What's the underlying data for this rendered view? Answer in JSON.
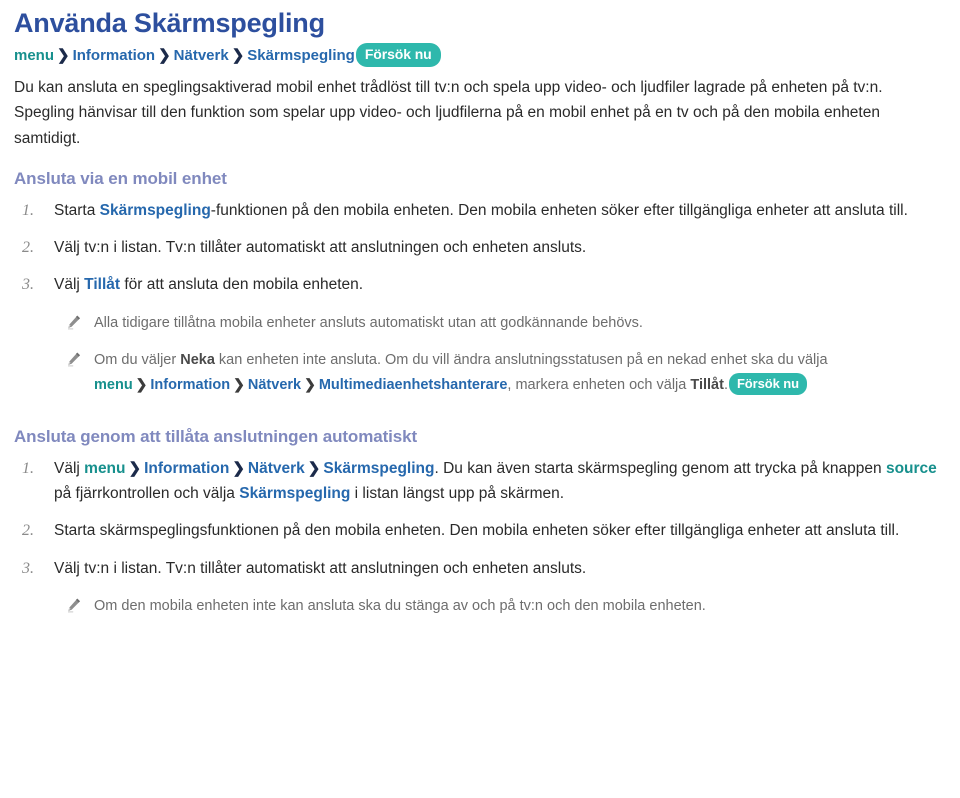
{
  "title": "Använda Skärmspegling",
  "colors": {
    "title_blue": "#2d4f9e",
    "link_blue": "#2668ad",
    "menu_teal": "#17908d",
    "badge_teal": "#2eb8ac",
    "heading_periwinkle": "#8089be",
    "note_gray": "#6d6d6d",
    "body_text": "#2a2a2a"
  },
  "breadcrumb": {
    "menu": "menu",
    "separator": "❯",
    "item1": "Information",
    "item2": "Nätverk",
    "item3": "Skärmspegling",
    "badge": "Försök nu"
  },
  "intro": "Du kan ansluta en speglingsaktiverad mobil enhet trådlöst till tv:n och spela upp video- och ljudfiler lagrade på enheten på tv:n. Spegling hänvisar till den funktion som spelar upp video- och ljudfilerna på en mobil enhet på en tv och på den mobila enheten samtidigt.",
  "section1": {
    "heading": "Ansluta via en mobil enhet",
    "steps": [
      {
        "num": "1.",
        "pre": "Starta ",
        "kw": "Skärmspegling",
        "post": "-funktionen på den mobila enheten. Den mobila enheten söker efter tillgängliga enheter att ansluta till."
      },
      {
        "num": "2.",
        "pre": "Välj tv:n i listan. Tv:n tillåter automatiskt att anslutningen och enheten ansluts.",
        "kw": "",
        "post": ""
      },
      {
        "num": "3.",
        "pre": "Välj ",
        "kw": "Tillåt",
        "post": " för att ansluta den mobila enheten."
      }
    ],
    "notes": [
      {
        "icon": "pencil-icon",
        "text": "Alla tidigare tillåtna mobila enheter ansluts automatiskt utan att godkännande behövs."
      }
    ],
    "note2": {
      "icon": "pencil-icon",
      "line1_pre": "Om du väljer ",
      "line1_kw": "Neka",
      "line1_post": " kan enheten inte ansluta. Om du vill ändra anslutningsstatusen på en nekad enhet ska du välja",
      "crumb_menu": "menu",
      "crumb_sep": "❯",
      "crumb1": "Information",
      "crumb2": "Nätverk",
      "crumb3": "Multimediaenhetshanterare",
      "line2_mid": ", markera enheten och välja ",
      "line2_kw": "Tillåt",
      "line2_end": ".",
      "badge": "Försök nu"
    }
  },
  "section2": {
    "heading": "Ansluta genom att tillåta anslutningen automatiskt",
    "step1": {
      "num": "1.",
      "pre": "Välj ",
      "crumb_menu": "menu",
      "crumb_sep": "❯",
      "crumb1": "Information",
      "crumb2": "Nätverk",
      "crumb3": "Skärmspegling",
      "mid": ". Du kan även starta skärmspegling genom att trycka på knappen ",
      "kw_source": "source",
      "mid2": " på fjärrkontrollen och välja ",
      "kw_screen": "Skärmspegling",
      "end": " i listan längst upp på skärmen."
    },
    "step2": {
      "num": "2.",
      "text": "Starta skärmspeglingsfunktionen på den mobila enheten. Den mobila enheten söker efter tillgängliga enheter att ansluta till."
    },
    "step3": {
      "num": "3.",
      "text": "Välj tv:n i listan. Tv:n tillåter automatiskt att anslutningen och enheten ansluts."
    },
    "note": {
      "icon": "pencil-icon",
      "text": "Om den mobila enheten inte kan ansluta ska du stänga av och på tv:n och den mobila enheten."
    }
  }
}
